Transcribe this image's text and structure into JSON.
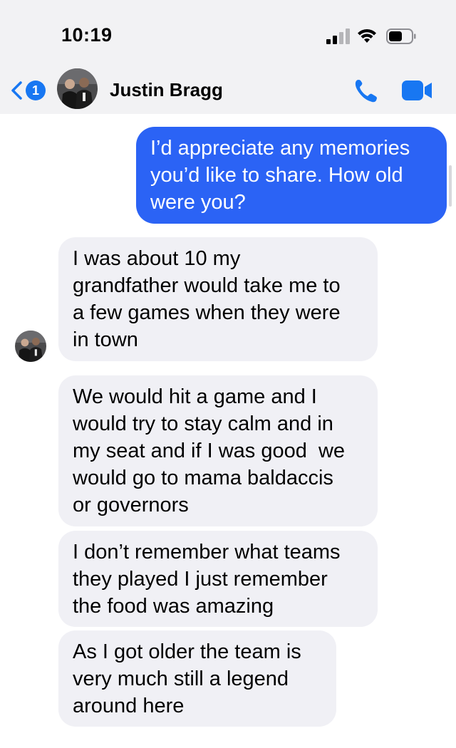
{
  "status_bar": {
    "time": "10:19"
  },
  "header": {
    "back_badge_count": "1",
    "contact_name": "Justin Bragg",
    "icons": [
      "chevron-left-icon",
      "phone-icon",
      "video-camera-icon"
    ]
  },
  "colors": {
    "accent": "#1877f2",
    "outgoing_bubble": "#2b63f5",
    "incoming_bubble": "#f0f0f5",
    "bar_background": "#f2f2f4"
  },
  "messages": [
    {
      "direction": "outgoing",
      "lines": [
        "I’d appreciate any memories",
        "you’d like to share. How old",
        "were you?"
      ]
    },
    {
      "direction": "incoming",
      "lines": [
        "I was about 10 my",
        "grandfather would take me to",
        "a few games when they were",
        "in town"
      ]
    },
    {
      "direction": "incoming",
      "lines": [
        "We would hit a game and I",
        "would try to stay calm and in",
        "my seat and if I was good  we",
        "would go to mama baldaccis",
        "or governors"
      ]
    },
    {
      "direction": "incoming",
      "lines": [
        "I don’t remember what teams",
        "they played I just remember",
        "the food was amazing"
      ]
    },
    {
      "direction": "incoming",
      "lines": [
        "As I got older the team is",
        "very much still a legend",
        "around here"
      ]
    }
  ]
}
